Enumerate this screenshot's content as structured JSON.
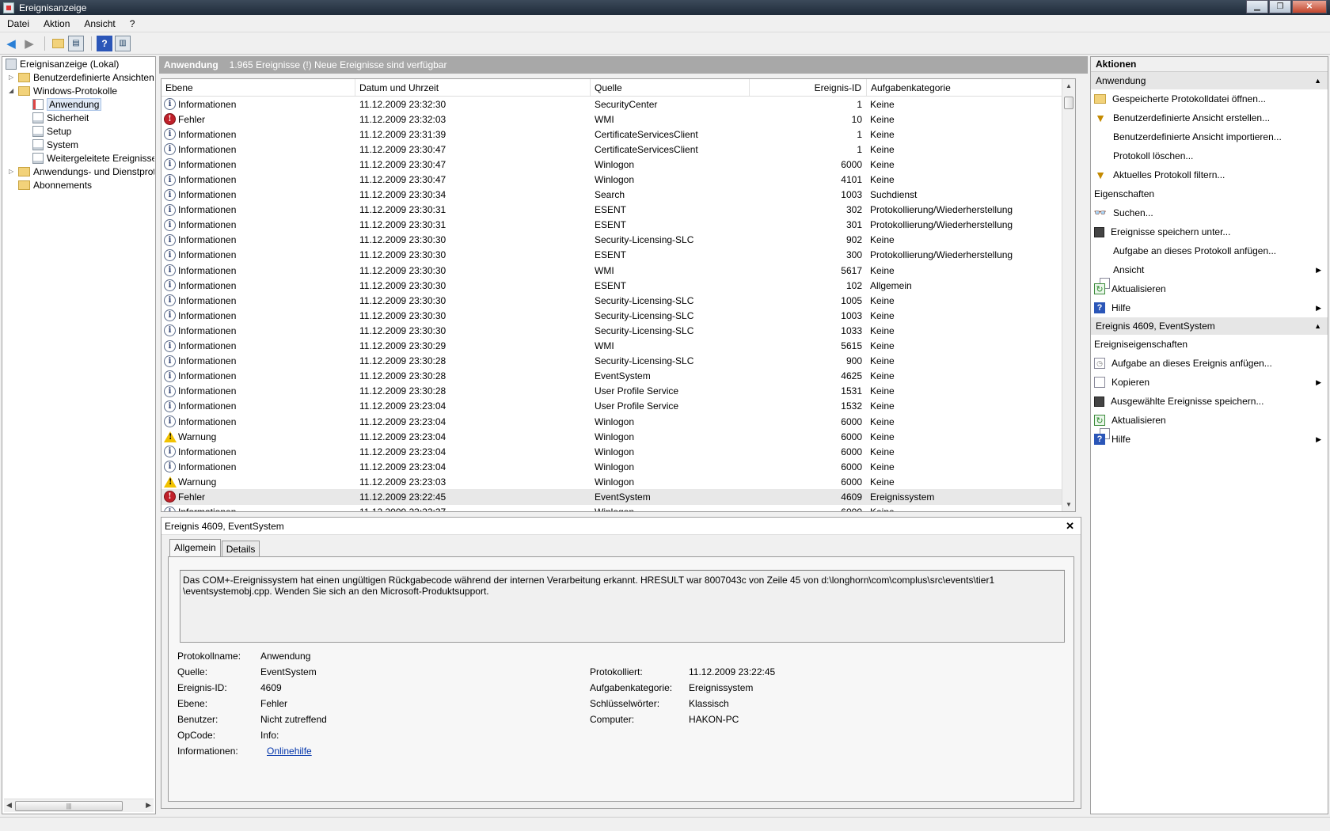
{
  "window": {
    "title": "Ereignisanzeige"
  },
  "menu": [
    "Datei",
    "Aktion",
    "Ansicht",
    "?"
  ],
  "tree": {
    "items": [
      {
        "label": "Ereignisanzeige (Lokal)"
      },
      {
        "label": "Benutzerdefinierte Ansichten"
      },
      {
        "label": "Windows-Protokolle"
      },
      {
        "label": "Anwendung"
      },
      {
        "label": "Sicherheit"
      },
      {
        "label": "Setup"
      },
      {
        "label": "System"
      },
      {
        "label": "Weitergeleitete Ereignisse"
      },
      {
        "label": "Anwendungs- und Dienstprotokolle"
      },
      {
        "label": "Abonnements"
      }
    ]
  },
  "center": {
    "log_name": "Anwendung",
    "summary": "1.965 Ereignisse (!) Neue Ereignisse sind verfügbar"
  },
  "grid": {
    "columns": [
      "Ebene",
      "Datum und Uhrzeit",
      "Quelle",
      "Ereignis-ID",
      "Aufgabenkategorie"
    ],
    "rows": [
      {
        "level": "Informationen",
        "date": "11.12.2009 23:32:30",
        "source": "SecurityCenter",
        "id": "1",
        "category": "Keine"
      },
      {
        "level": "Fehler",
        "date": "11.12.2009 23:32:03",
        "source": "WMI",
        "id": "10",
        "category": "Keine"
      },
      {
        "level": "Informationen",
        "date": "11.12.2009 23:31:39",
        "source": "CertificateServicesClient",
        "id": "1",
        "category": "Keine"
      },
      {
        "level": "Informationen",
        "date": "11.12.2009 23:30:47",
        "source": "CertificateServicesClient",
        "id": "1",
        "category": "Keine"
      },
      {
        "level": "Informationen",
        "date": "11.12.2009 23:30:47",
        "source": "Winlogon",
        "id": "6000",
        "category": "Keine"
      },
      {
        "level": "Informationen",
        "date": "11.12.2009 23:30:47",
        "source": "Winlogon",
        "id": "4101",
        "category": "Keine"
      },
      {
        "level": "Informationen",
        "date": "11.12.2009 23:30:34",
        "source": "Search",
        "id": "1003",
        "category": "Suchdienst"
      },
      {
        "level": "Informationen",
        "date": "11.12.2009 23:30:31",
        "source": "ESENT",
        "id": "302",
        "category": "Protokollierung/Wiederherstellung"
      },
      {
        "level": "Informationen",
        "date": "11.12.2009 23:30:31",
        "source": "ESENT",
        "id": "301",
        "category": "Protokollierung/Wiederherstellung"
      },
      {
        "level": "Informationen",
        "date": "11.12.2009 23:30:30",
        "source": "Security-Licensing-SLC",
        "id": "902",
        "category": "Keine"
      },
      {
        "level": "Informationen",
        "date": "11.12.2009 23:30:30",
        "source": "ESENT",
        "id": "300",
        "category": "Protokollierung/Wiederherstellung"
      },
      {
        "level": "Informationen",
        "date": "11.12.2009 23:30:30",
        "source": "WMI",
        "id": "5617",
        "category": "Keine"
      },
      {
        "level": "Informationen",
        "date": "11.12.2009 23:30:30",
        "source": "ESENT",
        "id": "102",
        "category": "Allgemein"
      },
      {
        "level": "Informationen",
        "date": "11.12.2009 23:30:30",
        "source": "Security-Licensing-SLC",
        "id": "1005",
        "category": "Keine"
      },
      {
        "level": "Informationen",
        "date": "11.12.2009 23:30:30",
        "source": "Security-Licensing-SLC",
        "id": "1003",
        "category": "Keine"
      },
      {
        "level": "Informationen",
        "date": "11.12.2009 23:30:30",
        "source": "Security-Licensing-SLC",
        "id": "1033",
        "category": "Keine"
      },
      {
        "level": "Informationen",
        "date": "11.12.2009 23:30:29",
        "source": "WMI",
        "id": "5615",
        "category": "Keine"
      },
      {
        "level": "Informationen",
        "date": "11.12.2009 23:30:28",
        "source": "Security-Licensing-SLC",
        "id": "900",
        "category": "Keine"
      },
      {
        "level": "Informationen",
        "date": "11.12.2009 23:30:28",
        "source": "EventSystem",
        "id": "4625",
        "category": "Keine"
      },
      {
        "level": "Informationen",
        "date": "11.12.2009 23:30:28",
        "source": "User Profile Service",
        "id": "1531",
        "category": "Keine"
      },
      {
        "level": "Informationen",
        "date": "11.12.2009 23:23:04",
        "source": "User Profile Service",
        "id": "1532",
        "category": "Keine"
      },
      {
        "level": "Informationen",
        "date": "11.12.2009 23:23:04",
        "source": "Winlogon",
        "id": "6000",
        "category": "Keine"
      },
      {
        "level": "Warnung",
        "date": "11.12.2009 23:23:04",
        "source": "Winlogon",
        "id": "6000",
        "category": "Keine"
      },
      {
        "level": "Informationen",
        "date": "11.12.2009 23:23:04",
        "source": "Winlogon",
        "id": "6000",
        "category": "Keine"
      },
      {
        "level": "Informationen",
        "date": "11.12.2009 23:23:04",
        "source": "Winlogon",
        "id": "6000",
        "category": "Keine"
      },
      {
        "level": "Warnung",
        "date": "11.12.2009 23:23:03",
        "source": "Winlogon",
        "id": "6000",
        "category": "Keine"
      },
      {
        "level": "Fehler",
        "date": "11.12.2009 23:22:45",
        "source": "EventSystem",
        "id": "4609",
        "category": "Ereignissystem",
        "selected": true
      },
      {
        "level": "Informationen",
        "date": "11.12.2009 23:22:37",
        "source": "Winlogon",
        "id": "6000",
        "category": "Keine"
      }
    ]
  },
  "detail": {
    "title": "Ereignis 4609, EventSystem",
    "tabs": [
      "Allgemein",
      "Details"
    ],
    "message": "Das COM+-Ereignissystem hat einen ungültigen Rückgabecode während der internen Verarbeitung erkannt. HRESULT war 8007043c von Zeile 45 von d:\\longhorn\\com\\complus\\src\\events\\tier1\n\\eventsystemobj.cpp. Wenden Sie sich an den Microsoft-Produktsupport.",
    "props_left": [
      {
        "k": "Protokollname:",
        "v": "Anwendung"
      },
      {
        "k": "Quelle:",
        "v": "EventSystem"
      },
      {
        "k": "Ereignis-ID:",
        "v": "4609"
      },
      {
        "k": "Ebene:",
        "v": "Fehler"
      },
      {
        "k": "Benutzer:",
        "v": "Nicht zutreffend"
      },
      {
        "k": "OpCode:",
        "v": "Info:"
      },
      {
        "k": "Informationen:",
        "v": "Onlinehilfe"
      }
    ],
    "props_right": [
      {
        "k": "Protokolliert:",
        "v": "11.12.2009 23:22:45"
      },
      {
        "k": "Aufgabenkategorie:",
        "v": "Ereignissystem"
      },
      {
        "k": "Schlüsselwörter:",
        "v": "Klassisch"
      },
      {
        "k": "Computer:",
        "v": "HAKON-PC"
      }
    ]
  },
  "actions": {
    "title": "Aktionen",
    "section1": "Anwendung",
    "items1": [
      {
        "label": "Gespeicherte Protokolldatei öffnen...",
        "icon": "folder"
      },
      {
        "label": "Benutzerdefinierte Ansicht erstellen...",
        "icon": "filter"
      },
      {
        "label": "Benutzerdefinierte Ansicht importieren...",
        "icon": "blank"
      },
      {
        "label": "Protokoll löschen...",
        "icon": "blank"
      },
      {
        "label": "Aktuelles Protokoll filtern...",
        "icon": "filter"
      },
      {
        "label": "Eigenschaften",
        "icon": "props"
      },
      {
        "label": "Suchen...",
        "icon": "find"
      },
      {
        "label": "Ereignisse speichern unter...",
        "icon": "save"
      },
      {
        "label": "Aufgabe an dieses Protokoll anfügen...",
        "icon": "blank"
      },
      {
        "label": "Ansicht",
        "icon": "blank",
        "submenu": true
      },
      {
        "label": "Aktualisieren",
        "icon": "refresh"
      },
      {
        "label": "Hilfe",
        "icon": "help",
        "submenu": true
      }
    ],
    "section2": "Ereignis 4609, EventSystem",
    "items2": [
      {
        "label": "Ereigniseigenschaften",
        "icon": "props"
      },
      {
        "label": "Aufgabe an dieses Ereignis anfügen...",
        "icon": "task"
      },
      {
        "label": "Kopieren",
        "icon": "copy",
        "submenu": true
      },
      {
        "label": "Ausgewählte Ereignisse speichern...",
        "icon": "save"
      },
      {
        "label": "Aktualisieren",
        "icon": "refresh"
      },
      {
        "label": "Hilfe",
        "icon": "help",
        "submenu": true
      }
    ]
  }
}
